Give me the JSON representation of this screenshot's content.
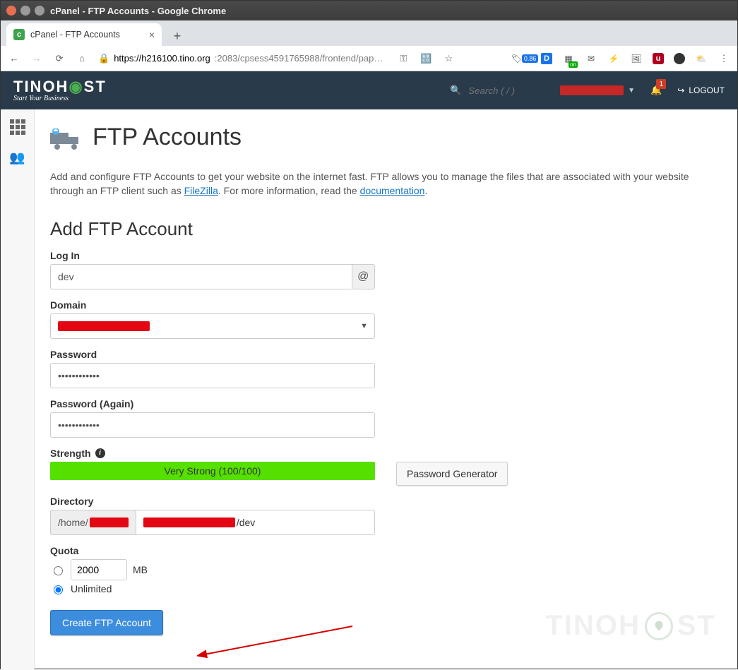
{
  "window": {
    "title": "cPanel - FTP Accounts - Google Chrome"
  },
  "browser": {
    "tab_title": "cPanel - FTP Accounts",
    "url_host": "https://h216100.tino.org",
    "url_rest": ":2083/cpsess4591765988/frontend/pap…",
    "badge_small": "0.86"
  },
  "topbar": {
    "brand_main": "TINOH",
    "brand_main2": "ST",
    "brand_sub": "Start Your Business",
    "search_placeholder": "Search ( / )",
    "bell_count": "1",
    "logout": "LOGOUT"
  },
  "page": {
    "title": "FTP Accounts",
    "intro_pre": "Add and configure FTP Accounts to get your website on the internet fast. FTP allows you to manage the files that are associated with your website through an FTP client such as ",
    "intro_link1": "FileZilla",
    "intro_mid": ". For more information, read the ",
    "intro_link2": "documentation",
    "intro_post": "."
  },
  "form": {
    "section_title": "Add FTP Account",
    "login_label": "Log In",
    "login_value": "dev",
    "login_addon": "@",
    "domain_label": "Domain",
    "password_label": "Password",
    "password_value": "••••••••••••",
    "password2_label": "Password (Again)",
    "password2_value": "••••••••••••",
    "strength_label": "Strength",
    "strength_text": "Very Strong (100/100)",
    "pw_generator": "Password Generator",
    "directory_label": "Directory",
    "dir_prefix": "/home/",
    "dir_suffix": "/dev",
    "quota_label": "Quota",
    "quota_value": "2000",
    "quota_unit": "MB",
    "quota_unlimited": "Unlimited",
    "submit": "Create FTP Account"
  },
  "watermark": {
    "text": "TINOH",
    "text2": "ST"
  }
}
